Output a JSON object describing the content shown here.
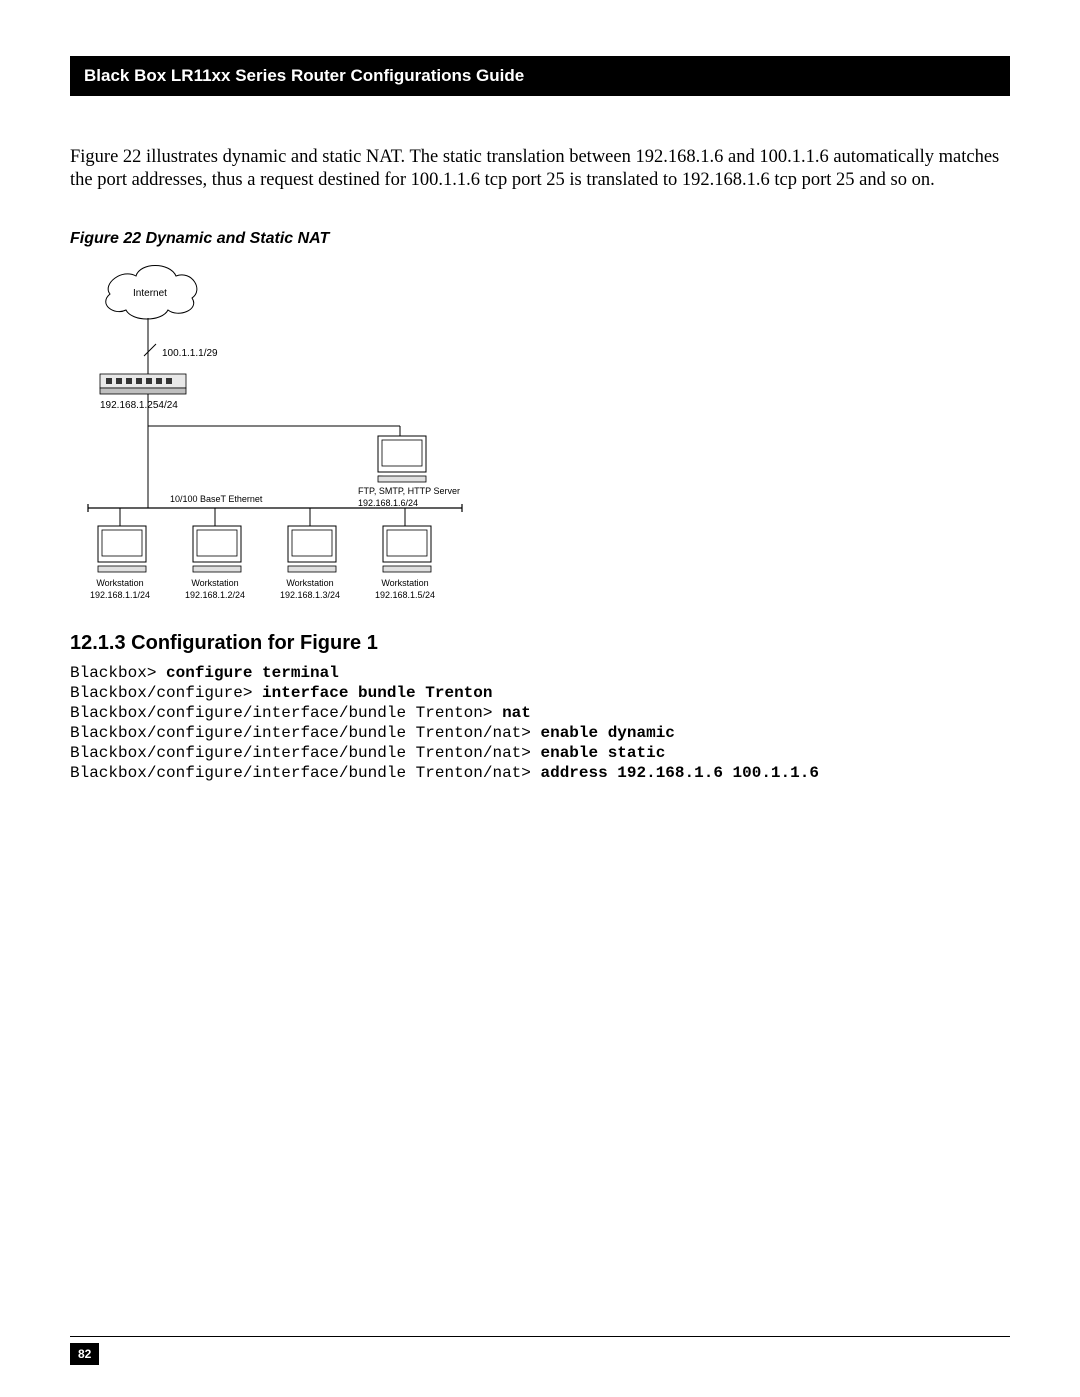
{
  "header": {
    "title": "Black Box LR11xx Series Router Configurations Guide"
  },
  "paragraph": "Figure 22 illustrates dynamic and static NAT. The static translation between 192.168.1.6 and 100.1.1.6 automatically matches the port addresses, thus a request destined for 100.1.1.6 tcp port 25 is translated to 192.168.1.6 tcp port 25 and so on.",
  "figure": {
    "caption": "Figure 22  Dynamic and Static NAT",
    "cloud_label": "Internet",
    "wan_ip": "100.1.1.1/29",
    "lan_ip": "192.168.1.254/24",
    "lan_label": "10/100 BaseT Ethernet",
    "server_label_1": "FTP, SMTP, HTTP Server",
    "server_label_2": "192.168.1.6/24",
    "workstations": [
      {
        "name": "Workstation",
        "ip": "192.168.1.1/24"
      },
      {
        "name": "Workstation",
        "ip": "192.168.1.2/24"
      },
      {
        "name": "Workstation",
        "ip": "192.168.1.3/24"
      },
      {
        "name": "Workstation",
        "ip": "192.168.1.5/24"
      }
    ]
  },
  "section_heading": "12.1.3 Configuration for Figure 1",
  "terminal": [
    {
      "prompt": "Blackbox> ",
      "cmd": "configure terminal"
    },
    {
      "prompt": "Blackbox/configure> ",
      "cmd": "interface bundle Trenton"
    },
    {
      "prompt": "Blackbox/configure/interface/bundle Trenton> ",
      "cmd": "nat"
    },
    {
      "prompt": "Blackbox/configure/interface/bundle Trenton/nat> ",
      "cmd": "enable dynamic"
    },
    {
      "prompt": "Blackbox/configure/interface/bundle Trenton/nat> ",
      "cmd": "enable static"
    },
    {
      "prompt": "Blackbox/configure/interface/bundle Trenton/nat> ",
      "cmd": "address 192.168.1.6 100.1.1.6"
    }
  ],
  "page_number": "82"
}
